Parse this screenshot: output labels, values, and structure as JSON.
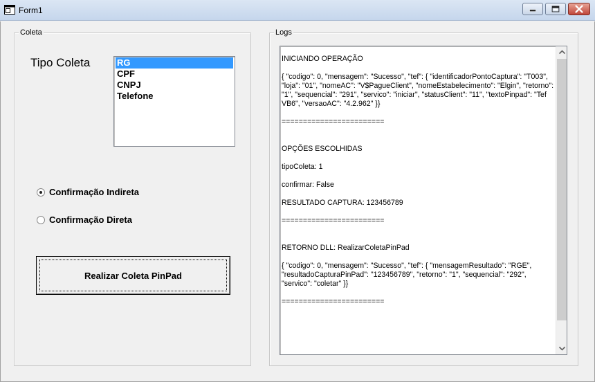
{
  "window": {
    "title": "Form1",
    "icons": {
      "app": "app-icon",
      "minimize": "minimize-icon",
      "maximize": "maximize-icon",
      "close": "close-icon"
    }
  },
  "coleta": {
    "group_label": "Coleta",
    "tipo_label": "Tipo Coleta",
    "list_items": [
      "RG",
      "CPF",
      "CNPJ",
      "Telefone"
    ],
    "selected_item": "RG",
    "radio_indireta": {
      "label": "Confirmação Indireta",
      "checked": true
    },
    "radio_direta": {
      "label": "Confirmação Direta",
      "checked": false
    },
    "action_button": "Realizar Coleta PinPad"
  },
  "logs": {
    "group_label": "Logs",
    "lines": [
      "INICIANDO OPERAÇÃO",
      "{    \"codigo\": 0,    \"mensagem\": \"Sucesso\",    \"tef\": {       \"identificadorPontoCaptura\": \"T003\",        \"loja\": \"01\",        \"nomeAC\": \"V$PagueClient\",        \"nomeEstabelecimento\": \"Elgin\",        \"retorno\": \"1\",        \"sequencial\": \"291\",        \"servico\": \"iniciar\",        \"statusClient\": \"11\",        \"textoPinpad\": \"Tef VB6\",        \"versaoAC\": \"4.2.962\"    }}",
      "========================",
      "OPÇÕES ESCOLHIDAS",
      "tipoColeta: 1",
      "confirmar: False",
      "RESULTADO CAPTURA: 123456789",
      "========================",
      "RETORNO DLL: RealizarColetaPinPad",
      "{    \"codigo\": 0,    \"mensagem\": \"Sucesso\",    \"tef\": {        \"mensagemResultado\": \"RGE\",        \"resultadoCapturaPinPad\": \"123456789\",        \"retorno\": \"1\",        \"sequencial\": \"292\",        \"servico\": \"coletar\"    }}",
      "========================"
    ],
    "scroll_icons": {
      "up": "chevron-up-icon",
      "down": "chevron-down-icon"
    }
  }
}
